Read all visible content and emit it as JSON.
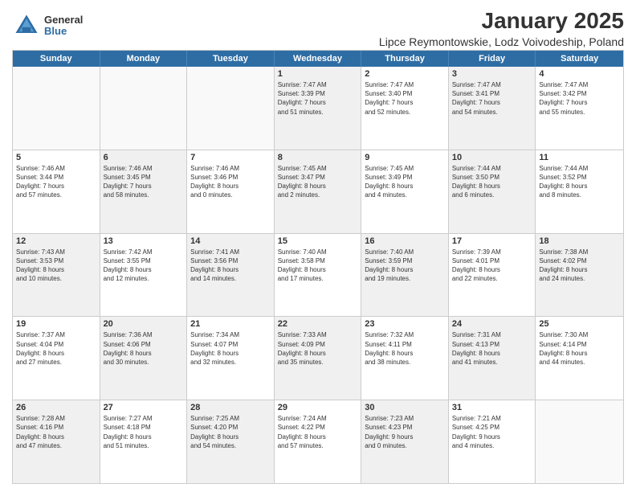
{
  "logo": {
    "general": "General",
    "blue": "Blue"
  },
  "title": "January 2025",
  "subtitle": "Lipce Reymontowskie, Lodz Voivodeship, Poland",
  "headers": [
    "Sunday",
    "Monday",
    "Tuesday",
    "Wednesday",
    "Thursday",
    "Friday",
    "Saturday"
  ],
  "weeks": [
    [
      {
        "day": "",
        "info": "",
        "empty": true
      },
      {
        "day": "",
        "info": "",
        "empty": true
      },
      {
        "day": "",
        "info": "",
        "empty": true
      },
      {
        "day": "1",
        "info": "Sunrise: 7:47 AM\nSunset: 3:39 PM\nDaylight: 7 hours\nand 51 minutes.",
        "shaded": true
      },
      {
        "day": "2",
        "info": "Sunrise: 7:47 AM\nSunset: 3:40 PM\nDaylight: 7 hours\nand 52 minutes.",
        "shaded": false
      },
      {
        "day": "3",
        "info": "Sunrise: 7:47 AM\nSunset: 3:41 PM\nDaylight: 7 hours\nand 54 minutes.",
        "shaded": true
      },
      {
        "day": "4",
        "info": "Sunrise: 7:47 AM\nSunset: 3:42 PM\nDaylight: 7 hours\nand 55 minutes.",
        "shaded": false
      }
    ],
    [
      {
        "day": "5",
        "info": "Sunrise: 7:46 AM\nSunset: 3:44 PM\nDaylight: 7 hours\nand 57 minutes.",
        "shaded": false
      },
      {
        "day": "6",
        "info": "Sunrise: 7:46 AM\nSunset: 3:45 PM\nDaylight: 7 hours\nand 58 minutes.",
        "shaded": true
      },
      {
        "day": "7",
        "info": "Sunrise: 7:46 AM\nSunset: 3:46 PM\nDaylight: 8 hours\nand 0 minutes.",
        "shaded": false
      },
      {
        "day": "8",
        "info": "Sunrise: 7:45 AM\nSunset: 3:47 PM\nDaylight: 8 hours\nand 2 minutes.",
        "shaded": true
      },
      {
        "day": "9",
        "info": "Sunrise: 7:45 AM\nSunset: 3:49 PM\nDaylight: 8 hours\nand 4 minutes.",
        "shaded": false
      },
      {
        "day": "10",
        "info": "Sunrise: 7:44 AM\nSunset: 3:50 PM\nDaylight: 8 hours\nand 6 minutes.",
        "shaded": true
      },
      {
        "day": "11",
        "info": "Sunrise: 7:44 AM\nSunset: 3:52 PM\nDaylight: 8 hours\nand 8 minutes.",
        "shaded": false
      }
    ],
    [
      {
        "day": "12",
        "info": "Sunrise: 7:43 AM\nSunset: 3:53 PM\nDaylight: 8 hours\nand 10 minutes.",
        "shaded": true
      },
      {
        "day": "13",
        "info": "Sunrise: 7:42 AM\nSunset: 3:55 PM\nDaylight: 8 hours\nand 12 minutes.",
        "shaded": false
      },
      {
        "day": "14",
        "info": "Sunrise: 7:41 AM\nSunset: 3:56 PM\nDaylight: 8 hours\nand 14 minutes.",
        "shaded": true
      },
      {
        "day": "15",
        "info": "Sunrise: 7:40 AM\nSunset: 3:58 PM\nDaylight: 8 hours\nand 17 minutes.",
        "shaded": false
      },
      {
        "day": "16",
        "info": "Sunrise: 7:40 AM\nSunset: 3:59 PM\nDaylight: 8 hours\nand 19 minutes.",
        "shaded": true
      },
      {
        "day": "17",
        "info": "Sunrise: 7:39 AM\nSunset: 4:01 PM\nDaylight: 8 hours\nand 22 minutes.",
        "shaded": false
      },
      {
        "day": "18",
        "info": "Sunrise: 7:38 AM\nSunset: 4:02 PM\nDaylight: 8 hours\nand 24 minutes.",
        "shaded": true
      }
    ],
    [
      {
        "day": "19",
        "info": "Sunrise: 7:37 AM\nSunset: 4:04 PM\nDaylight: 8 hours\nand 27 minutes.",
        "shaded": false
      },
      {
        "day": "20",
        "info": "Sunrise: 7:36 AM\nSunset: 4:06 PM\nDaylight: 8 hours\nand 30 minutes.",
        "shaded": true
      },
      {
        "day": "21",
        "info": "Sunrise: 7:34 AM\nSunset: 4:07 PM\nDaylight: 8 hours\nand 32 minutes.",
        "shaded": false
      },
      {
        "day": "22",
        "info": "Sunrise: 7:33 AM\nSunset: 4:09 PM\nDaylight: 8 hours\nand 35 minutes.",
        "shaded": true
      },
      {
        "day": "23",
        "info": "Sunrise: 7:32 AM\nSunset: 4:11 PM\nDaylight: 8 hours\nand 38 minutes.",
        "shaded": false
      },
      {
        "day": "24",
        "info": "Sunrise: 7:31 AM\nSunset: 4:13 PM\nDaylight: 8 hours\nand 41 minutes.",
        "shaded": true
      },
      {
        "day": "25",
        "info": "Sunrise: 7:30 AM\nSunset: 4:14 PM\nDaylight: 8 hours\nand 44 minutes.",
        "shaded": false
      }
    ],
    [
      {
        "day": "26",
        "info": "Sunrise: 7:28 AM\nSunset: 4:16 PM\nDaylight: 8 hours\nand 47 minutes.",
        "shaded": true
      },
      {
        "day": "27",
        "info": "Sunrise: 7:27 AM\nSunset: 4:18 PM\nDaylight: 8 hours\nand 51 minutes.",
        "shaded": false
      },
      {
        "day": "28",
        "info": "Sunrise: 7:25 AM\nSunset: 4:20 PM\nDaylight: 8 hours\nand 54 minutes.",
        "shaded": true
      },
      {
        "day": "29",
        "info": "Sunrise: 7:24 AM\nSunset: 4:22 PM\nDaylight: 8 hours\nand 57 minutes.",
        "shaded": false
      },
      {
        "day": "30",
        "info": "Sunrise: 7:23 AM\nSunset: 4:23 PM\nDaylight: 9 hours\nand 0 minutes.",
        "shaded": true
      },
      {
        "day": "31",
        "info": "Sunrise: 7:21 AM\nSunset: 4:25 PM\nDaylight: 9 hours\nand 4 minutes.",
        "shaded": false
      },
      {
        "day": "",
        "info": "",
        "empty": true
      }
    ]
  ]
}
